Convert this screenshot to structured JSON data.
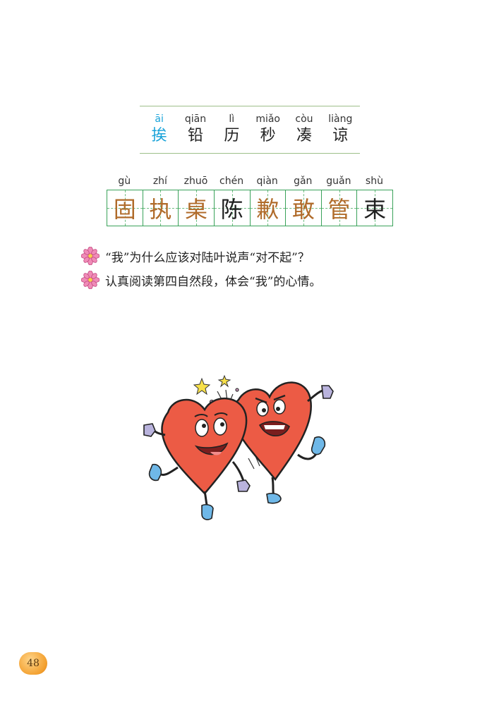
{
  "read_chars": [
    {
      "pinyin": "āi",
      "hanzi": "挨",
      "highlight": true
    },
    {
      "pinyin": "qiān",
      "hanzi": "铅",
      "highlight": false
    },
    {
      "pinyin": "lì",
      "hanzi": "历",
      "highlight": false
    },
    {
      "pinyin": "miǎo",
      "hanzi": "秒",
      "highlight": false
    },
    {
      "pinyin": "còu",
      "hanzi": "凑",
      "highlight": false
    },
    {
      "pinyin": "liàng",
      "hanzi": "谅",
      "highlight": false
    }
  ],
  "write_chars": [
    {
      "pinyin": "gù",
      "hanzi": "固"
    },
    {
      "pinyin": "zhí",
      "hanzi": "执"
    },
    {
      "pinyin": "zhuō",
      "hanzi": "桌"
    },
    {
      "pinyin": "chén",
      "hanzi": "陈"
    },
    {
      "pinyin": "qiàn",
      "hanzi": "歉"
    },
    {
      "pinyin": "gǎn",
      "hanzi": "敢"
    },
    {
      "pinyin": "guǎn",
      "hanzi": "管"
    },
    {
      "pinyin": "shù",
      "hanzi": "束"
    }
  ],
  "questions": [
    "“我”为什么应该对陆叶说声“对不起”？",
    "认真阅读第四自然段，体会“我”的心情。"
  ],
  "page_number": "48",
  "colors": {
    "highlight_blue": "#1aa3d9",
    "grid_green": "#3aa25a",
    "char_brown": "#b06b2a",
    "heart_red": "#ec5b45",
    "page_badge_orange": "#f3a02f"
  }
}
